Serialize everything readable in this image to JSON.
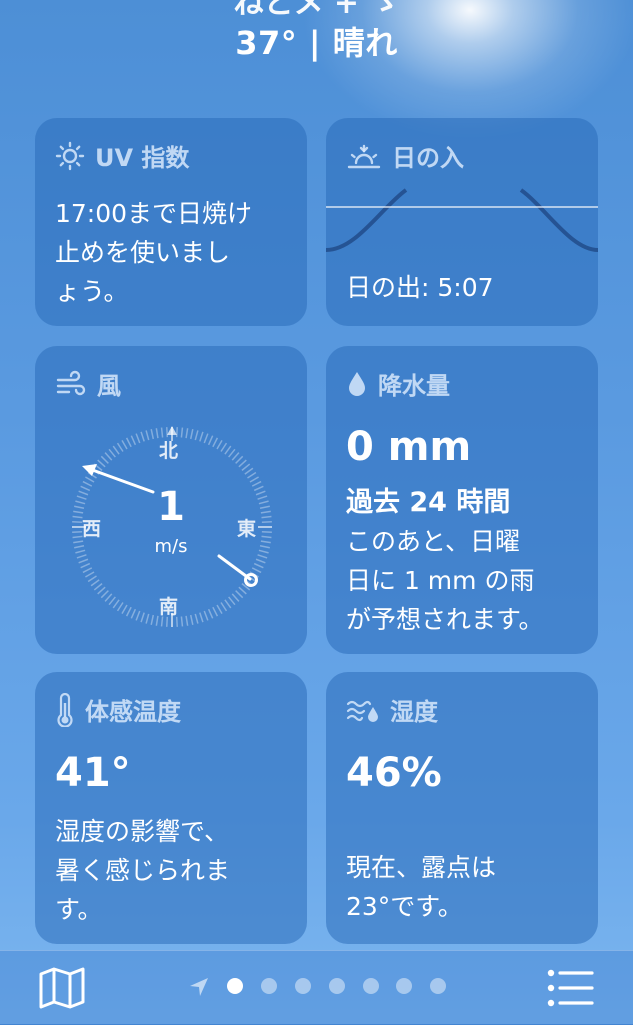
{
  "header": {
    "location_cutoff": "ねとメ + ゝ",
    "temp_condition": "37° | 晴れ"
  },
  "uv_card": {
    "title": "UV 指数",
    "lines": [
      "17:00まで日焼け",
      "止めを使いまし",
      "ょう。"
    ]
  },
  "sunset_card": {
    "title": "日の入",
    "sunrise_label": "日の出: 5:07"
  },
  "wind_card": {
    "title": "風",
    "speed": "1",
    "unit": "m/s",
    "north": "北",
    "east": "東",
    "south": "南",
    "west": "西"
  },
  "precip_card": {
    "title": "降水量",
    "amount": "0 mm",
    "period": "過去 24 時間",
    "lines": [
      "このあと、日曜",
      "日に 1 mm の雨",
      "が予想されます。"
    ]
  },
  "feels_card": {
    "title": "体感温度",
    "value": "41°",
    "lines": [
      "湿度の影響で、",
      "暑く感じられま",
      "す。"
    ]
  },
  "humidity_card": {
    "title": "湿度",
    "value": "46%",
    "lines": [
      "現在、露点は",
      "23°です。"
    ]
  },
  "toolbar": {
    "map_icon": "map-icon",
    "location_icon": "location-arrow-icon",
    "list_icon": "list-icon",
    "page_count": 6,
    "active_page": 0
  }
}
